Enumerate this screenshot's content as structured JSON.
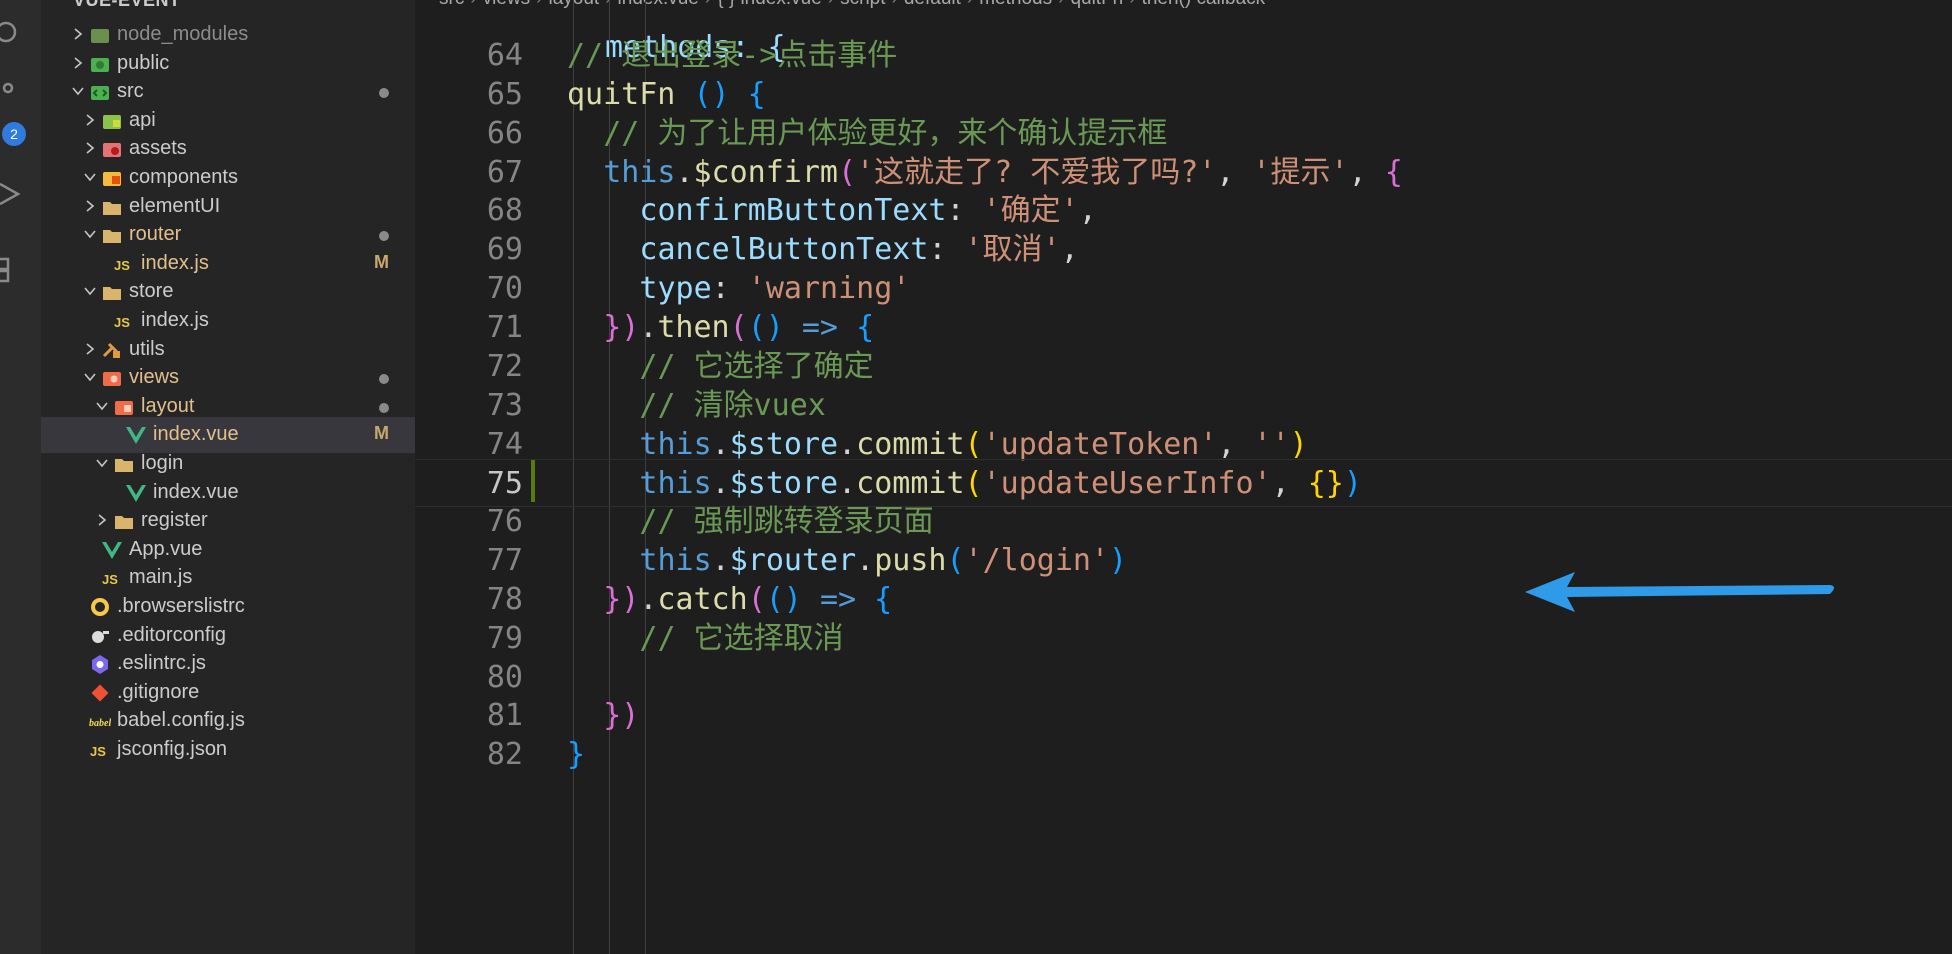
{
  "activity": {
    "badge": "2"
  },
  "explorer": {
    "title": "VUE-EVENT",
    "items": [
      {
        "label": "node_modules",
        "icon": "node-modules-folder-icon",
        "chev": "right",
        "depth": 0,
        "dim": true
      },
      {
        "label": "public",
        "icon": "public-folder-icon",
        "chev": "right",
        "depth": 0
      },
      {
        "label": "src",
        "icon": "src-folder-icon",
        "chev": "down",
        "depth": 0,
        "status": "dot"
      },
      {
        "label": "api",
        "icon": "api-folder-icon",
        "chev": "right",
        "depth": 1
      },
      {
        "label": "assets",
        "icon": "assets-folder-icon",
        "chev": "right",
        "depth": 1
      },
      {
        "label": "components",
        "icon": "components-folder-icon",
        "chev": "down",
        "depth": 1
      },
      {
        "label": "elementUI",
        "icon": "folder-icon",
        "chev": "right",
        "depth": 1
      },
      {
        "label": "router",
        "icon": "router-folder-icon",
        "chev": "down",
        "depth": 1,
        "status": "dot",
        "git": true
      },
      {
        "label": "index.js",
        "icon": "js-file-icon",
        "depth": 2,
        "status": "M",
        "git": true
      },
      {
        "label": "store",
        "icon": "store-folder-icon",
        "chev": "down",
        "depth": 1
      },
      {
        "label": "index.js",
        "icon": "js-file-icon",
        "depth": 2
      },
      {
        "label": "utils",
        "icon": "utils-folder-icon",
        "chev": "right",
        "depth": 1
      },
      {
        "label": "views",
        "icon": "views-folder-icon",
        "chev": "down",
        "depth": 1,
        "status": "dot",
        "git": true
      },
      {
        "label": "layout",
        "icon": "layout-folder-icon",
        "chev": "down",
        "depth": 2,
        "status": "dot",
        "git": true
      },
      {
        "label": "index.vue",
        "icon": "vue-file-icon",
        "depth": 3,
        "status": "M",
        "git": true,
        "selected": true
      },
      {
        "label": "login",
        "icon": "folder-icon",
        "chev": "down",
        "depth": 2
      },
      {
        "label": "index.vue",
        "icon": "vue-file-icon",
        "depth": 3
      },
      {
        "label": "register",
        "icon": "folder-icon",
        "chev": "right",
        "depth": 2
      },
      {
        "label": "App.vue",
        "icon": "vue-file-icon",
        "depth": 1
      },
      {
        "label": "main.js",
        "icon": "js-file-icon",
        "depth": 1
      },
      {
        "label": ".browserslistrc",
        "icon": "browserslist-icon",
        "depth": 0
      },
      {
        "label": ".editorconfig",
        "icon": "editorconfig-icon",
        "depth": 0
      },
      {
        "label": ".eslintrc.js",
        "icon": "eslint-icon",
        "depth": 0
      },
      {
        "label": ".gitignore",
        "icon": "git-icon",
        "depth": 0
      },
      {
        "label": "babel.config.js",
        "icon": "babel-icon",
        "depth": 0
      },
      {
        "label": "jsconfig.json",
        "icon": "js-file-icon",
        "depth": 0
      }
    ]
  },
  "breadcrumb": [
    "src",
    "views",
    "layout",
    "index.vue",
    "{ } index.vue",
    "script",
    "default",
    "methods",
    "quitFn",
    "then() callback"
  ],
  "editor": {
    "partial_line": "methods: {",
    "lines": [
      {
        "n": "64",
        "indent": 1,
        "tokens": [
          [
            "cm",
            "// 退出登录->点击事件"
          ]
        ]
      },
      {
        "n": "65",
        "indent": 1,
        "tokens": [
          [
            "fn",
            "quitFn"
          ],
          [
            "df",
            " "
          ],
          [
            "p2",
            "()"
          ],
          [
            "df",
            " "
          ],
          [
            "p2",
            "{"
          ]
        ]
      },
      {
        "n": "66",
        "indent": 2,
        "tokens": [
          [
            "cm",
            "// 为了让用户体验更好，来个确认提示框"
          ]
        ]
      },
      {
        "n": "67",
        "indent": 2,
        "tokens": [
          [
            "kw",
            "this"
          ],
          [
            "df",
            "."
          ],
          [
            "fn",
            "$confirm"
          ],
          [
            "p1",
            "("
          ],
          [
            "st",
            "'这就走了? 不爱我了吗?'"
          ],
          [
            "df",
            ", "
          ],
          [
            "st",
            "'提示'"
          ],
          [
            "df",
            ", "
          ],
          [
            "p1",
            "{"
          ]
        ]
      },
      {
        "n": "68",
        "indent": 3,
        "tokens": [
          [
            "pr",
            "confirmButtonText"
          ],
          [
            "df",
            ": "
          ],
          [
            "st",
            "'确定'"
          ],
          [
            "df",
            ","
          ]
        ]
      },
      {
        "n": "69",
        "indent": 3,
        "tokens": [
          [
            "pr",
            "cancelButtonText"
          ],
          [
            "df",
            ": "
          ],
          [
            "st",
            "'取消'"
          ],
          [
            "df",
            ","
          ]
        ]
      },
      {
        "n": "70",
        "indent": 3,
        "tokens": [
          [
            "pr",
            "type"
          ],
          [
            "df",
            ": "
          ],
          [
            "st",
            "'warning'"
          ]
        ]
      },
      {
        "n": "71",
        "indent": 2,
        "tokens": [
          [
            "p1",
            "})"
          ],
          [
            "df",
            "."
          ],
          [
            "fn",
            "then"
          ],
          [
            "p1",
            "("
          ],
          [
            "p2",
            "()"
          ],
          [
            "df",
            " "
          ],
          [
            "kw",
            "=>"
          ],
          [
            "df",
            " "
          ],
          [
            "p2",
            "{"
          ]
        ]
      },
      {
        "n": "72",
        "indent": 3,
        "tokens": [
          [
            "cm",
            "// 它选择了确定"
          ]
        ]
      },
      {
        "n": "73",
        "indent": 3,
        "tokens": [
          [
            "cm",
            "// 清除vuex"
          ]
        ]
      },
      {
        "n": "74",
        "indent": 3,
        "tokens": [
          [
            "kw",
            "this"
          ],
          [
            "df",
            "."
          ],
          [
            "pr",
            "$store"
          ],
          [
            "df",
            "."
          ],
          [
            "fn",
            "commit"
          ],
          [
            "p3",
            "("
          ],
          [
            "st",
            "'updateToken'"
          ],
          [
            "df",
            ", "
          ],
          [
            "st",
            "''"
          ],
          [
            "p3",
            ")"
          ]
        ]
      },
      {
        "n": "75",
        "indent": 3,
        "current": true,
        "tokens": [
          [
            "kw",
            "this"
          ],
          [
            "df",
            "."
          ],
          [
            "pr",
            "$store"
          ],
          [
            "df",
            "."
          ],
          [
            "fn",
            "commit"
          ],
          [
            "p3",
            "("
          ],
          [
            "st",
            "'updateUserInfo'"
          ],
          [
            "df",
            ", "
          ],
          [
            "p3",
            "{}"
          ],
          [
            "p2",
            ")"
          ]
        ]
      },
      {
        "n": "76",
        "indent": 3,
        "tokens": [
          [
            "cm",
            "// 强制跳转登录页面"
          ]
        ]
      },
      {
        "n": "77",
        "indent": 3,
        "tokens": [
          [
            "kw",
            "this"
          ],
          [
            "df",
            "."
          ],
          [
            "pr",
            "$router"
          ],
          [
            "df",
            "."
          ],
          [
            "fn",
            "push"
          ],
          [
            "p2",
            "("
          ],
          [
            "st",
            "'/login'"
          ],
          [
            "p2",
            ")"
          ]
        ]
      },
      {
        "n": "78",
        "indent": 2,
        "tokens": [
          [
            "p1",
            "})"
          ],
          [
            "df",
            "."
          ],
          [
            "fn",
            "catch"
          ],
          [
            "p1",
            "("
          ],
          [
            "p2",
            "()"
          ],
          [
            "df",
            " "
          ],
          [
            "kw",
            "=>"
          ],
          [
            "df",
            " "
          ],
          [
            "p2",
            "{"
          ]
        ]
      },
      {
        "n": "79",
        "indent": 3,
        "tokens": [
          [
            "cm",
            "// 它选择取消"
          ]
        ]
      },
      {
        "n": "80",
        "indent": 3,
        "tokens": []
      },
      {
        "n": "81",
        "indent": 2,
        "tokens": [
          [
            "p1",
            "})"
          ]
        ]
      },
      {
        "n": "82",
        "indent": 1,
        "tokens": [
          [
            "p2",
            "}"
          ]
        ]
      }
    ]
  },
  "colors": {
    "arrow": "#2f9be8",
    "selection": "#37373d",
    "modified_bar": "#587c0c"
  }
}
